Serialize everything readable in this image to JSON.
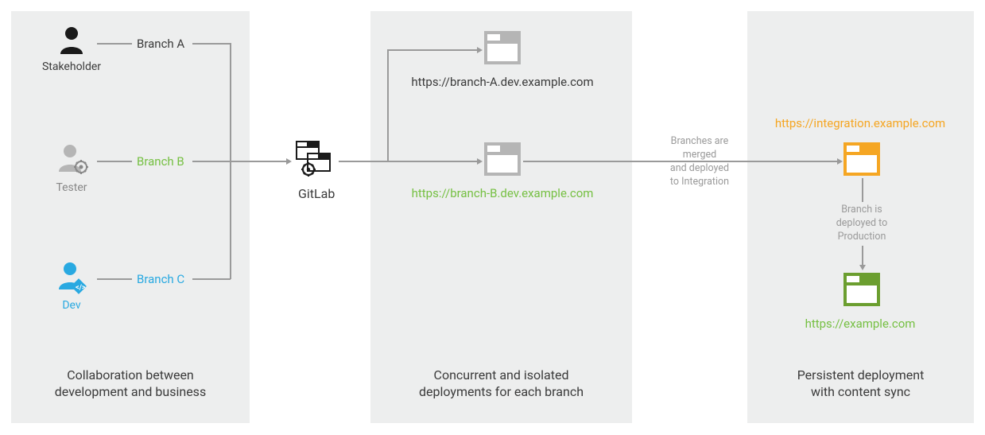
{
  "roles": {
    "stakeholder": {
      "label": "Stakeholder",
      "branch": "Branch A",
      "color": "#1a1a1a"
    },
    "tester": {
      "label": "Tester",
      "branch": "Branch B",
      "color": "#76c043"
    },
    "dev": {
      "label": "Dev",
      "branch": "Branch C",
      "color": "#29a9e1"
    }
  },
  "gitlab": {
    "label": "GitLab"
  },
  "envs": {
    "branchA": {
      "url": "https://branch-A.dev.example.com",
      "color": "#3a3a3a"
    },
    "branchB": {
      "url": "https://branch-B.dev.example.com",
      "color": "#76c043"
    },
    "integration": {
      "url": "https://integration.example.com",
      "color": "#f5a623"
    },
    "production": {
      "url": "https://example.com",
      "color": "#76c043"
    }
  },
  "notes": {
    "merge": "Branches are\nmerged\nand deployed\nto Integration",
    "deploy": "Branch is\ndeployed to\nProduction"
  },
  "captions": {
    "left": "Collaboration between\ndevelopment and business",
    "mid": "Concurrent and isolated\ndeployments for each branch",
    "right": "Persistent deployment\nwith content sync"
  }
}
